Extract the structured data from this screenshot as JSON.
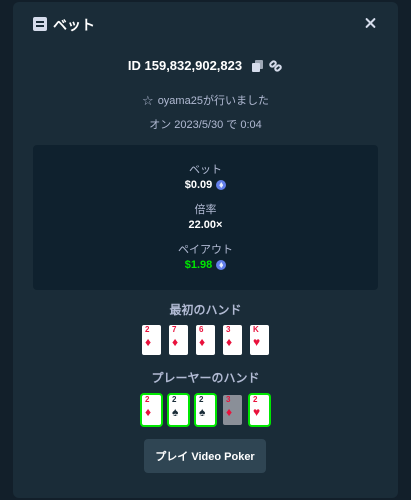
{
  "modal": {
    "title": "ベット",
    "bet_id": "ID 159,832,902,823",
    "placed_by": "oyama25が行いました",
    "date": "オン 2023/5/30 で 0:04"
  },
  "stats": {
    "bet_label": "ベット",
    "bet_value": "$0.09",
    "multiplier_label": "倍率",
    "multiplier_value": "22.00×",
    "payout_label": "ペイアウト",
    "payout_value": "$1.98",
    "currency_icon": "ethereum-icon"
  },
  "first_hand": {
    "title": "最初のハンド",
    "cards": [
      {
        "rank": "2",
        "suit": "♦",
        "color": "red"
      },
      {
        "rank": "7",
        "suit": "♦",
        "color": "red"
      },
      {
        "rank": "6",
        "suit": "♦",
        "color": "red"
      },
      {
        "rank": "3",
        "suit": "♦",
        "color": "red"
      },
      {
        "rank": "K",
        "suit": "♥",
        "color": "red"
      }
    ]
  },
  "player_hand": {
    "title": "プレーヤーのハンド",
    "cards": [
      {
        "rank": "2",
        "suit": "♦",
        "color": "red",
        "state": "held"
      },
      {
        "rank": "2",
        "suit": "♠",
        "color": "black",
        "state": "held"
      },
      {
        "rank": "2",
        "suit": "♠",
        "color": "black",
        "state": "held"
      },
      {
        "rank": "3",
        "suit": "♦",
        "color": "red",
        "state": "discarded"
      },
      {
        "rank": "2",
        "suit": "♥",
        "color": "red",
        "state": "held"
      }
    ]
  },
  "play_button": {
    "label": "プレイ Video Poker"
  },
  "colors": {
    "background": "#0f1923",
    "modal": "#1a2c38",
    "panel": "#0f212e",
    "button": "#2f4553",
    "win": "#00e701",
    "card_red": "#e9113c"
  }
}
